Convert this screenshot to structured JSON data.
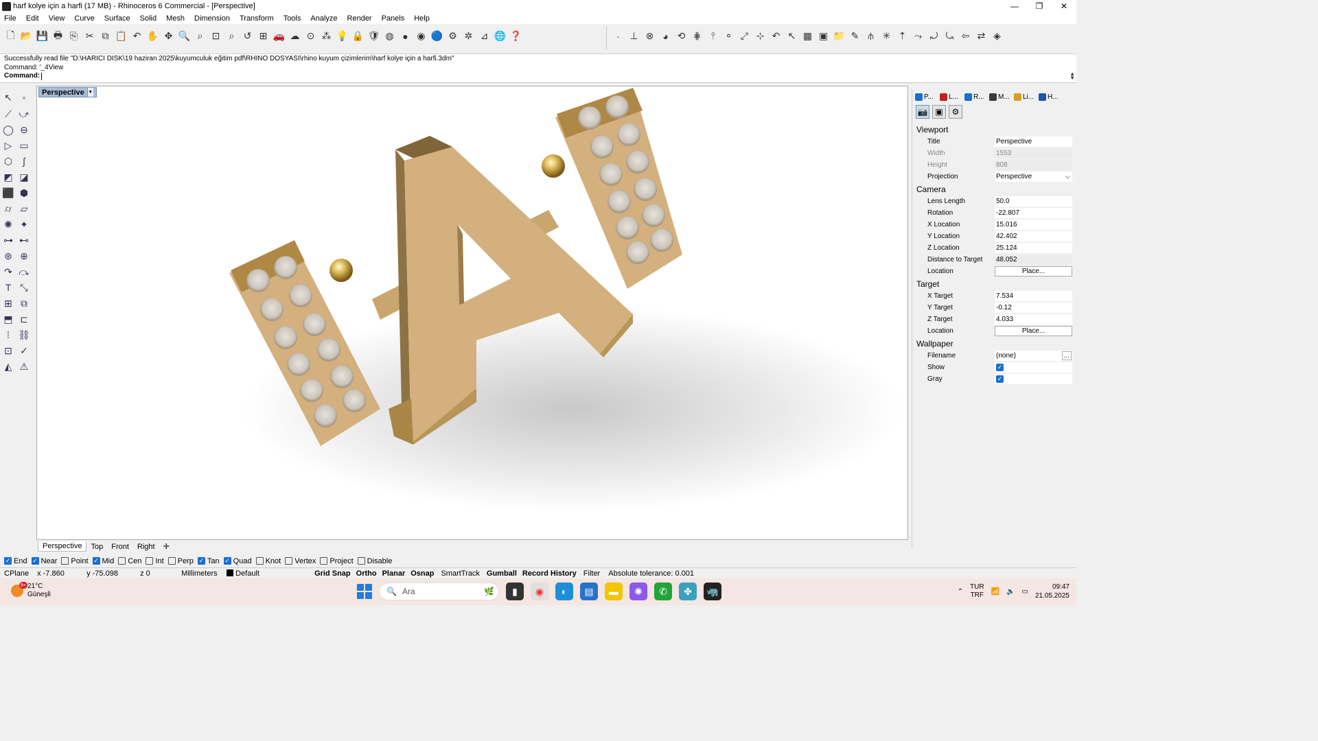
{
  "window": {
    "title": "harf kolye için a harfi (17 MB) - Rhinoceros 6 Commercial - [Perspective]",
    "controls": [
      "—",
      "❐",
      "✕"
    ]
  },
  "menu": [
    "File",
    "Edit",
    "View",
    "Curve",
    "Surface",
    "Solid",
    "Mesh",
    "Dimension",
    "Transform",
    "Tools",
    "Analyze",
    "Render",
    "Panels",
    "Help"
  ],
  "command": {
    "history": [
      "Successfully read file \"D:\\HARICI DISK\\19 haziran 2025\\kuyumculuk eğitim pdf\\RHINO DOSYASI\\rhino kuyum çizimlerim\\harf kolye için a harfi.3dm\"",
      "Command: '_4View"
    ],
    "prompt_label": "Command:",
    "input_value": ""
  },
  "viewport": {
    "label": "Perspective",
    "tabs": [
      "Perspective",
      "Top",
      "Front",
      "Right"
    ],
    "add_tab": "✛"
  },
  "panel": {
    "tabs": [
      "P...",
      "L...",
      "R...",
      "M...",
      "Li...",
      "H..."
    ],
    "tab_colors": [
      "#1a6fd0",
      "#c02020",
      "#1a6fd0",
      "#3a3a3a",
      "#d8a020",
      "#2050b0"
    ],
    "viewport_section": "Viewport",
    "title_k": "Title",
    "title_v": "Perspective",
    "width_k": "Width",
    "width_v": "1553",
    "height_k": "Height",
    "height_v": "808",
    "projection_k": "Projection",
    "projection_v": "Perspective",
    "camera_section": "Camera",
    "lens_k": "Lens Length",
    "lens_v": "50.0",
    "rot_k": "Rotation",
    "rot_v": "-22.807",
    "xloc_k": "X Location",
    "xloc_v": "15.016",
    "yloc_k": "Y Location",
    "yloc_v": "42.402",
    "zloc_k": "Z Location",
    "zloc_v": "25.124",
    "dist_k": "Distance to Target",
    "dist_v": "48.052",
    "camloc_k": "Location",
    "camloc_btn": "Place...",
    "target_section": "Target",
    "xt_k": "X Target",
    "xt_v": "7.534",
    "yt_k": "Y Target",
    "yt_v": "-0.12",
    "zt_k": "Z Target",
    "zt_v": "4.033",
    "tloc_k": "Location",
    "tloc_btn": "Place...",
    "wallpaper_section": "Wallpaper",
    "file_k": "Filename",
    "file_v": "(none)",
    "file_btn": "...",
    "show_k": "Show",
    "gray_k": "Gray"
  },
  "osnaps": [
    {
      "label": "End",
      "on": true
    },
    {
      "label": "Near",
      "on": true
    },
    {
      "label": "Point",
      "on": false
    },
    {
      "label": "Mid",
      "on": true
    },
    {
      "label": "Cen",
      "on": false
    },
    {
      "label": "Int",
      "on": false
    },
    {
      "label": "Perp",
      "on": false
    },
    {
      "label": "Tan",
      "on": true
    },
    {
      "label": "Quad",
      "on": true
    },
    {
      "label": "Knot",
      "on": false
    },
    {
      "label": "Vertex",
      "on": false
    },
    {
      "label": "Project",
      "on": false
    },
    {
      "label": "Disable",
      "on": false
    }
  ],
  "status": {
    "cplane": "CPlane",
    "x": "x -7.860",
    "y": "y -75.098",
    "z": "z 0",
    "units": "Millimeters",
    "layer": "Default",
    "grid_snap": "Grid Snap",
    "ortho": "Ortho",
    "planar": "Planar",
    "osnap": "Osnap",
    "smarttrack": "SmartTrack",
    "gumball": "Gumball",
    "record_history": "Record History",
    "filter": "Filter",
    "tolerance": "Absolute tolerance: 0.001"
  },
  "taskbar": {
    "temp": "21°C",
    "weather": "Güneşli",
    "badge": "9+",
    "search": "Ara",
    "lang1": "TUR",
    "lang2": "TRF",
    "time": "09:47",
    "date": "21.05.2025"
  }
}
